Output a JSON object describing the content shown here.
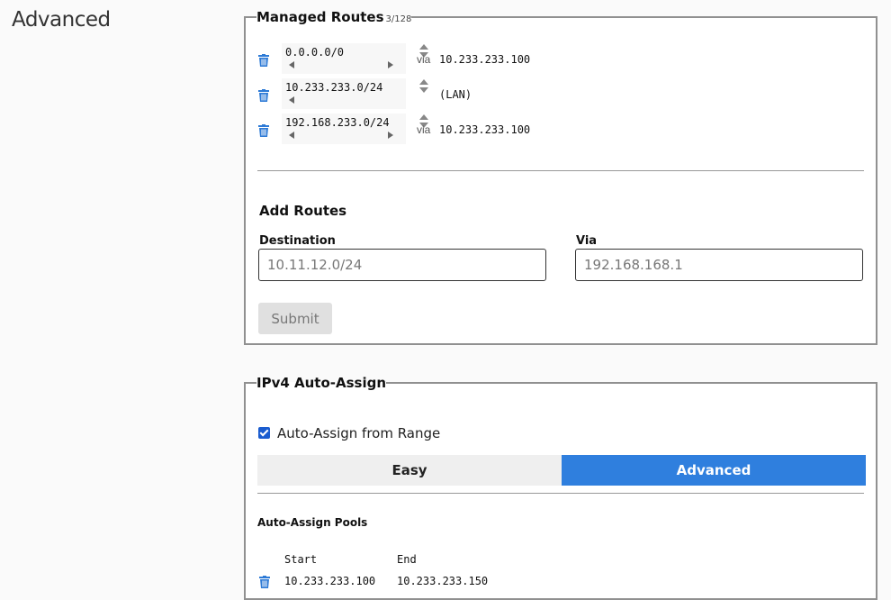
{
  "page": {
    "title": "Advanced"
  },
  "managed_routes": {
    "legend": "Managed Routes",
    "count": "3/128",
    "routes": [
      {
        "destination": "0.0.0.0/0",
        "via_label": "via",
        "via": "10.233.233.100"
      },
      {
        "destination": "10.233.233.0/24",
        "via_label": "",
        "via": "(LAN)"
      },
      {
        "destination": "192.168.233.0/24",
        "via_label": "via",
        "via": "10.233.233.100"
      }
    ],
    "add": {
      "heading": "Add Routes",
      "destination_label": "Destination",
      "destination_placeholder": "10.11.12.0/24",
      "via_label": "Via",
      "via_placeholder": "192.168.168.1",
      "submit_label": "Submit"
    }
  },
  "ipv4_auto_assign": {
    "legend": "IPv4 Auto-Assign",
    "checkbox_label": "Auto-Assign from Range",
    "checked": true,
    "tabs": [
      "Easy",
      "Advanced"
    ],
    "active_tab": "Advanced",
    "pools_title": "Auto-Assign Pools",
    "pool_headers": [
      "Start",
      "End"
    ],
    "pools": [
      {
        "start": "10.233.233.100",
        "end": "10.233.233.150"
      }
    ]
  },
  "colors": {
    "accent": "#2f7fde",
    "trash_icon": "#2d7ad6"
  },
  "icons": {
    "delete": "trash-icon",
    "spinner": "spinner-arrows-icon",
    "checkbox": "checkbox-checked-icon"
  }
}
